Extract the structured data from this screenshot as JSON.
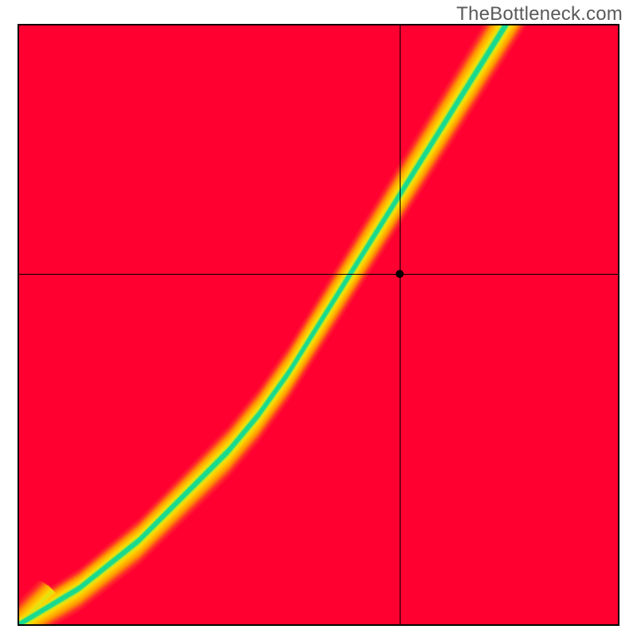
{
  "watermark": "TheBottleneck.com",
  "chart_data": {
    "type": "heatmap",
    "title": "",
    "xlabel": "",
    "ylabel": "",
    "xlim": [
      0,
      1
    ],
    "ylim": [
      0,
      1
    ],
    "crosshair": {
      "x": 0.635,
      "y": 0.585
    },
    "marker": {
      "x": 0.635,
      "y": 0.585
    },
    "ridge_curve": [
      {
        "x": 0.0,
        "y": 0.0
      },
      {
        "x": 0.05,
        "y": 0.03
      },
      {
        "x": 0.1,
        "y": 0.06
      },
      {
        "x": 0.15,
        "y": 0.1
      },
      {
        "x": 0.2,
        "y": 0.14
      },
      {
        "x": 0.25,
        "y": 0.19
      },
      {
        "x": 0.3,
        "y": 0.24
      },
      {
        "x": 0.35,
        "y": 0.29
      },
      {
        "x": 0.4,
        "y": 0.35
      },
      {
        "x": 0.45,
        "y": 0.42
      },
      {
        "x": 0.5,
        "y": 0.5
      },
      {
        "x": 0.55,
        "y": 0.58
      },
      {
        "x": 0.6,
        "y": 0.66
      },
      {
        "x": 0.65,
        "y": 0.74
      },
      {
        "x": 0.7,
        "y": 0.82
      },
      {
        "x": 0.75,
        "y": 0.9
      },
      {
        "x": 0.8,
        "y": 0.98
      }
    ],
    "ridge_width": 0.055,
    "origin_singularity_radius": 0.08,
    "palette": {
      "good": "#17da8f",
      "good_yellow": "#d9e81a",
      "mid": "#ffd400",
      "warm": "#ff9a00",
      "bad": "#ff2a2a",
      "deep_red": "#ff0030"
    }
  }
}
